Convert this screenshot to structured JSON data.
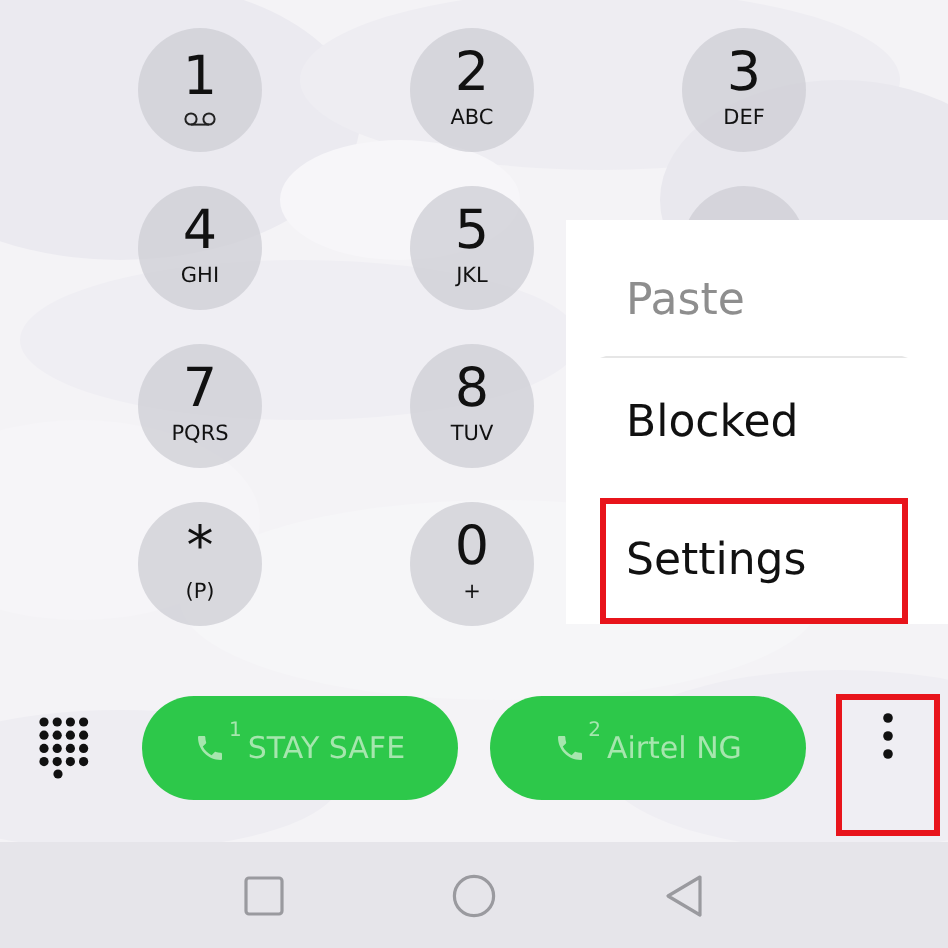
{
  "keypad": [
    [
      {
        "kind": "voicemail",
        "digit": "1"
      },
      {
        "kind": "digit",
        "digit": "2",
        "letters": "ABC"
      },
      {
        "kind": "digit",
        "digit": "3",
        "letters": "DEF"
      }
    ],
    [
      {
        "kind": "digit",
        "digit": "4",
        "letters": "GHI"
      },
      {
        "kind": "digit",
        "digit": "5",
        "letters": "JKL"
      },
      {
        "kind": "covered"
      }
    ],
    [
      {
        "kind": "digit",
        "digit": "7",
        "letters": "PQRS"
      },
      {
        "kind": "digit",
        "digit": "8",
        "letters": "TUV"
      }
    ],
    [
      {
        "kind": "digit",
        "digit": "*",
        "letters": "(P)"
      },
      {
        "kind": "digit",
        "digit": "0",
        "letters": "+"
      }
    ]
  ],
  "menu": {
    "items": [
      {
        "label": "Paste",
        "disabled": true,
        "highlighted": false
      },
      {
        "label": "Blocked",
        "disabled": false,
        "highlighted": false
      },
      {
        "label": "Settings",
        "disabled": false,
        "highlighted": true
      }
    ]
  },
  "call_buttons": [
    {
      "sim": "1",
      "label": "STAY SAFE"
    },
    {
      "sim": "2",
      "label": "Airtel NG"
    }
  ],
  "more_button": {
    "highlighted": true
  }
}
